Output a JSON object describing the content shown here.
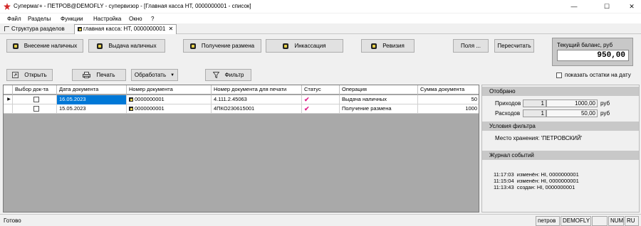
{
  "window": {
    "title": "Супермаг+ - ПЕТРОВ@DEMOFLY - супервизор  - [Главная касса НТ, 0000000001 - список]",
    "controls": {
      "minimize": "—",
      "maximize": "☐",
      "close": "✕"
    }
  },
  "menu": [
    {
      "underline": "Ф",
      "rest": "айл"
    },
    {
      "underline": "Р",
      "rest": "азделы"
    },
    {
      "underline": "",
      "pre": "Фун",
      "underline2": "к",
      "rest": "ции"
    },
    {
      "underline": "Н",
      "rest": "астройка"
    },
    {
      "underline": "О",
      "rest": "кно"
    },
    {
      "underline": "?",
      "rest": ""
    }
  ],
  "menu_labels": [
    "Файл",
    "Разделы",
    "Функции",
    "Настройка",
    "Окно",
    "?"
  ],
  "tabs": [
    {
      "label": "Структура разделов",
      "active": false
    },
    {
      "label": "главная касса: НТ, 0000000001",
      "active": true
    }
  ],
  "toolbar1": {
    "deposit": "Внесение наличных",
    "withdrawal": "Выдача наличных",
    "change": "Получение размена",
    "collection": "Инкассация",
    "audit": "Ревизия",
    "fields": "Поля ...",
    "recalc": "Пересчитать"
  },
  "balance": {
    "label": "Текущий баланс, руб",
    "value": "950,00"
  },
  "toolbar2": {
    "open": "Открыть",
    "print": "Печать",
    "process": "Обработать",
    "filter": "Фильтр",
    "show_remainders": "показать остатки на дату"
  },
  "grid": {
    "columns": [
      "Выбор док-та",
      "Дата документа",
      "Номер документа",
      "Номер документа для печати",
      "Статус",
      "Операция",
      "Сумма документа"
    ],
    "rows": [
      {
        "date": "16.05.2023",
        "doc_no": "0000000001",
        "print_no": "4.111.2.45063",
        "status": "✔",
        "operation": "Выдача наличных",
        "sum": "50"
      },
      {
        "date": "15.05.2023",
        "doc_no": "0000000001",
        "print_no": "4ПКО230615001",
        "status": "✔",
        "operation": "Получение размена",
        "sum": "1000"
      }
    ]
  },
  "selected": {
    "title": "Отобрано",
    "incoming_label": "Приходов",
    "incoming_count": "1",
    "incoming_sum": "1000,00",
    "outgoing_label": "Расходов",
    "outgoing_count": "1",
    "outgoing_sum": "50,00",
    "currency": "руб"
  },
  "filter_conditions": {
    "title": "Условия фильтра",
    "text": "Место хранения: 'ПЕТРОВСКИЙ'"
  },
  "event_log": {
    "title": "Журнал событий",
    "lines": [
      "11:17:03  изменён: НI, 0000000001",
      "11:15:04  изменён: НI, 0000000001",
      "11:13:43  создан: НI, 0000000001"
    ]
  },
  "status": {
    "text": "Готово",
    "user": "петров",
    "db": "DEMOFLY",
    "num": "NUM",
    "lang": "RU"
  }
}
